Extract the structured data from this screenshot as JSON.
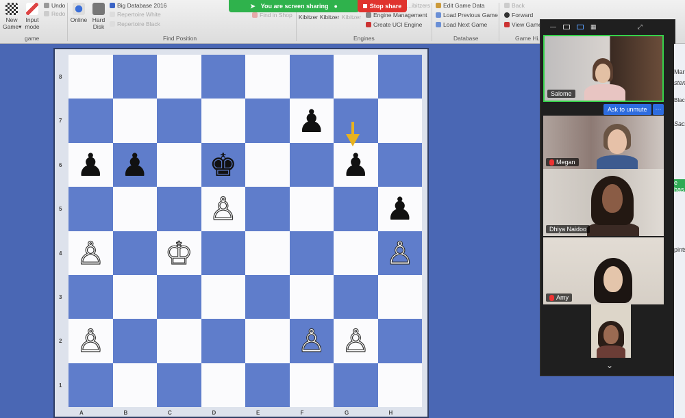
{
  "ribbon": {
    "buttons": [
      {
        "name": "new-game-button",
        "label": "New Game▾"
      },
      {
        "name": "input-mode-button",
        "label": "Input mode"
      },
      {
        "name": "online-button",
        "label": "Online"
      },
      {
        "name": "hard-disk-button",
        "label": "Hard Disk"
      },
      {
        "name": "default-kibitzer-button",
        "label": "Default Kibitzer"
      },
      {
        "name": "add-kibitzer-button",
        "label": "Add Kibitzer"
      },
      {
        "name": "remove-kibitzer-button",
        "label": "Remove Kibitzer"
      }
    ],
    "undo": "Undo",
    "redo": "Redo",
    "big_database": "Big Database 2016",
    "repertoire_white": "Repertoire White",
    "repertoire_black": "Repertoire Black",
    "find_in_shop": "Find in Shop",
    "kibitzers": "...ibitzers",
    "engine_management": "Engine Management",
    "create_uci_engine": "Create UCI Engine",
    "edit_game_data": "Edit Game Data",
    "load_previous_game": "Load Previous Game",
    "load_next_game": "Load Next Game",
    "back": "Back",
    "forward": "Forward",
    "view_game": "View Game",
    "groups": {
      "game": "game",
      "find_position": "Find Position",
      "engines": "Engines",
      "database": "Database",
      "game_history": "Game Hi..."
    }
  },
  "zoom": {
    "sharing_text": "You are screen sharing",
    "stop_share": "Stop share",
    "ask_to_unmute": "Ask to unmute",
    "more": "···",
    "participants": [
      {
        "name": "Salome",
        "muted": false
      },
      {
        "name": "Megan",
        "muted": true
      },
      {
        "name": "Dhiya Naidoo",
        "muted": false
      },
      {
        "name": "Amy",
        "muted": true
      }
    ]
  },
  "board": {
    "ranks": [
      "8",
      "7",
      "6",
      "5",
      "4",
      "3",
      "2",
      "1"
    ],
    "files": [
      "A",
      "B",
      "C",
      "D",
      "E",
      "F",
      "G",
      "H"
    ],
    "glyphs": {
      "wK": "♔",
      "wP": "♙",
      "bK": "♚",
      "bP": "♟"
    },
    "pieces": [
      {
        "sq": "f7",
        "p": "bP"
      },
      {
        "sq": "a6",
        "p": "bP"
      },
      {
        "sq": "b6",
        "p": "bP"
      },
      {
        "sq": "d6",
        "p": "bK"
      },
      {
        "sq": "g6",
        "p": "bP"
      },
      {
        "sq": "d5",
        "p": "wP"
      },
      {
        "sq": "h5",
        "p": "bP"
      },
      {
        "sq": "a4",
        "p": "wP"
      },
      {
        "sq": "c4",
        "p": "wK"
      },
      {
        "sq": "h4",
        "p": "wP"
      },
      {
        "sq": "a2",
        "p": "wP"
      },
      {
        "sq": "f2",
        "p": "wP"
      },
      {
        "sq": "g2",
        "p": "wP"
      }
    ],
    "last_move_arrow_to": "g6",
    "colors": {
      "light": "#fbfbfd",
      "dark": "#5f7dcb",
      "arrow": "#e8b21f"
    }
  },
  "right_edge": {
    "frags": [
      "Mar",
      "sten]",
      "Black",
      "Sacr",
      "e has",
      "pints"
    ]
  }
}
